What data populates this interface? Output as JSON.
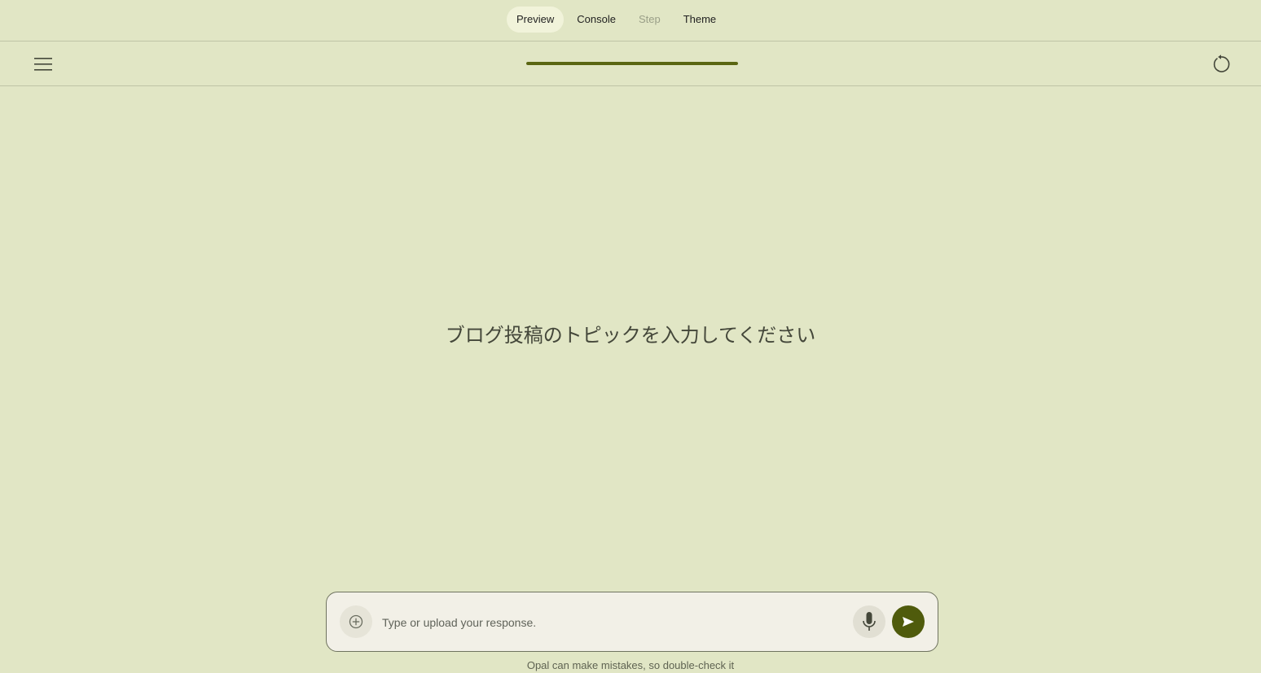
{
  "tabs": [
    {
      "label": "Preview",
      "state": "active"
    },
    {
      "label": "Console",
      "state": "normal"
    },
    {
      "label": "Step",
      "state": "disabled"
    },
    {
      "label": "Theme",
      "state": "normal"
    }
  ],
  "toolbar": {
    "menu_icon": "hamburger-menu-icon",
    "restart_icon": "restart-icon",
    "progress": 1.0
  },
  "main": {
    "prompt": "ブログ投稿のトピックを入力してください"
  },
  "composer": {
    "placeholder": "Type or upload your response.",
    "value": "",
    "add_icon": "add-circle-icon",
    "mic_icon": "microphone-icon",
    "send_icon": "send-icon"
  },
  "footer": {
    "disclaimer": "Opal can make mistakes, so double-check it"
  },
  "colors": {
    "background": "#e1e6c5",
    "accent": "#4f5b0c",
    "composer_bg": "#f2f0e7"
  }
}
